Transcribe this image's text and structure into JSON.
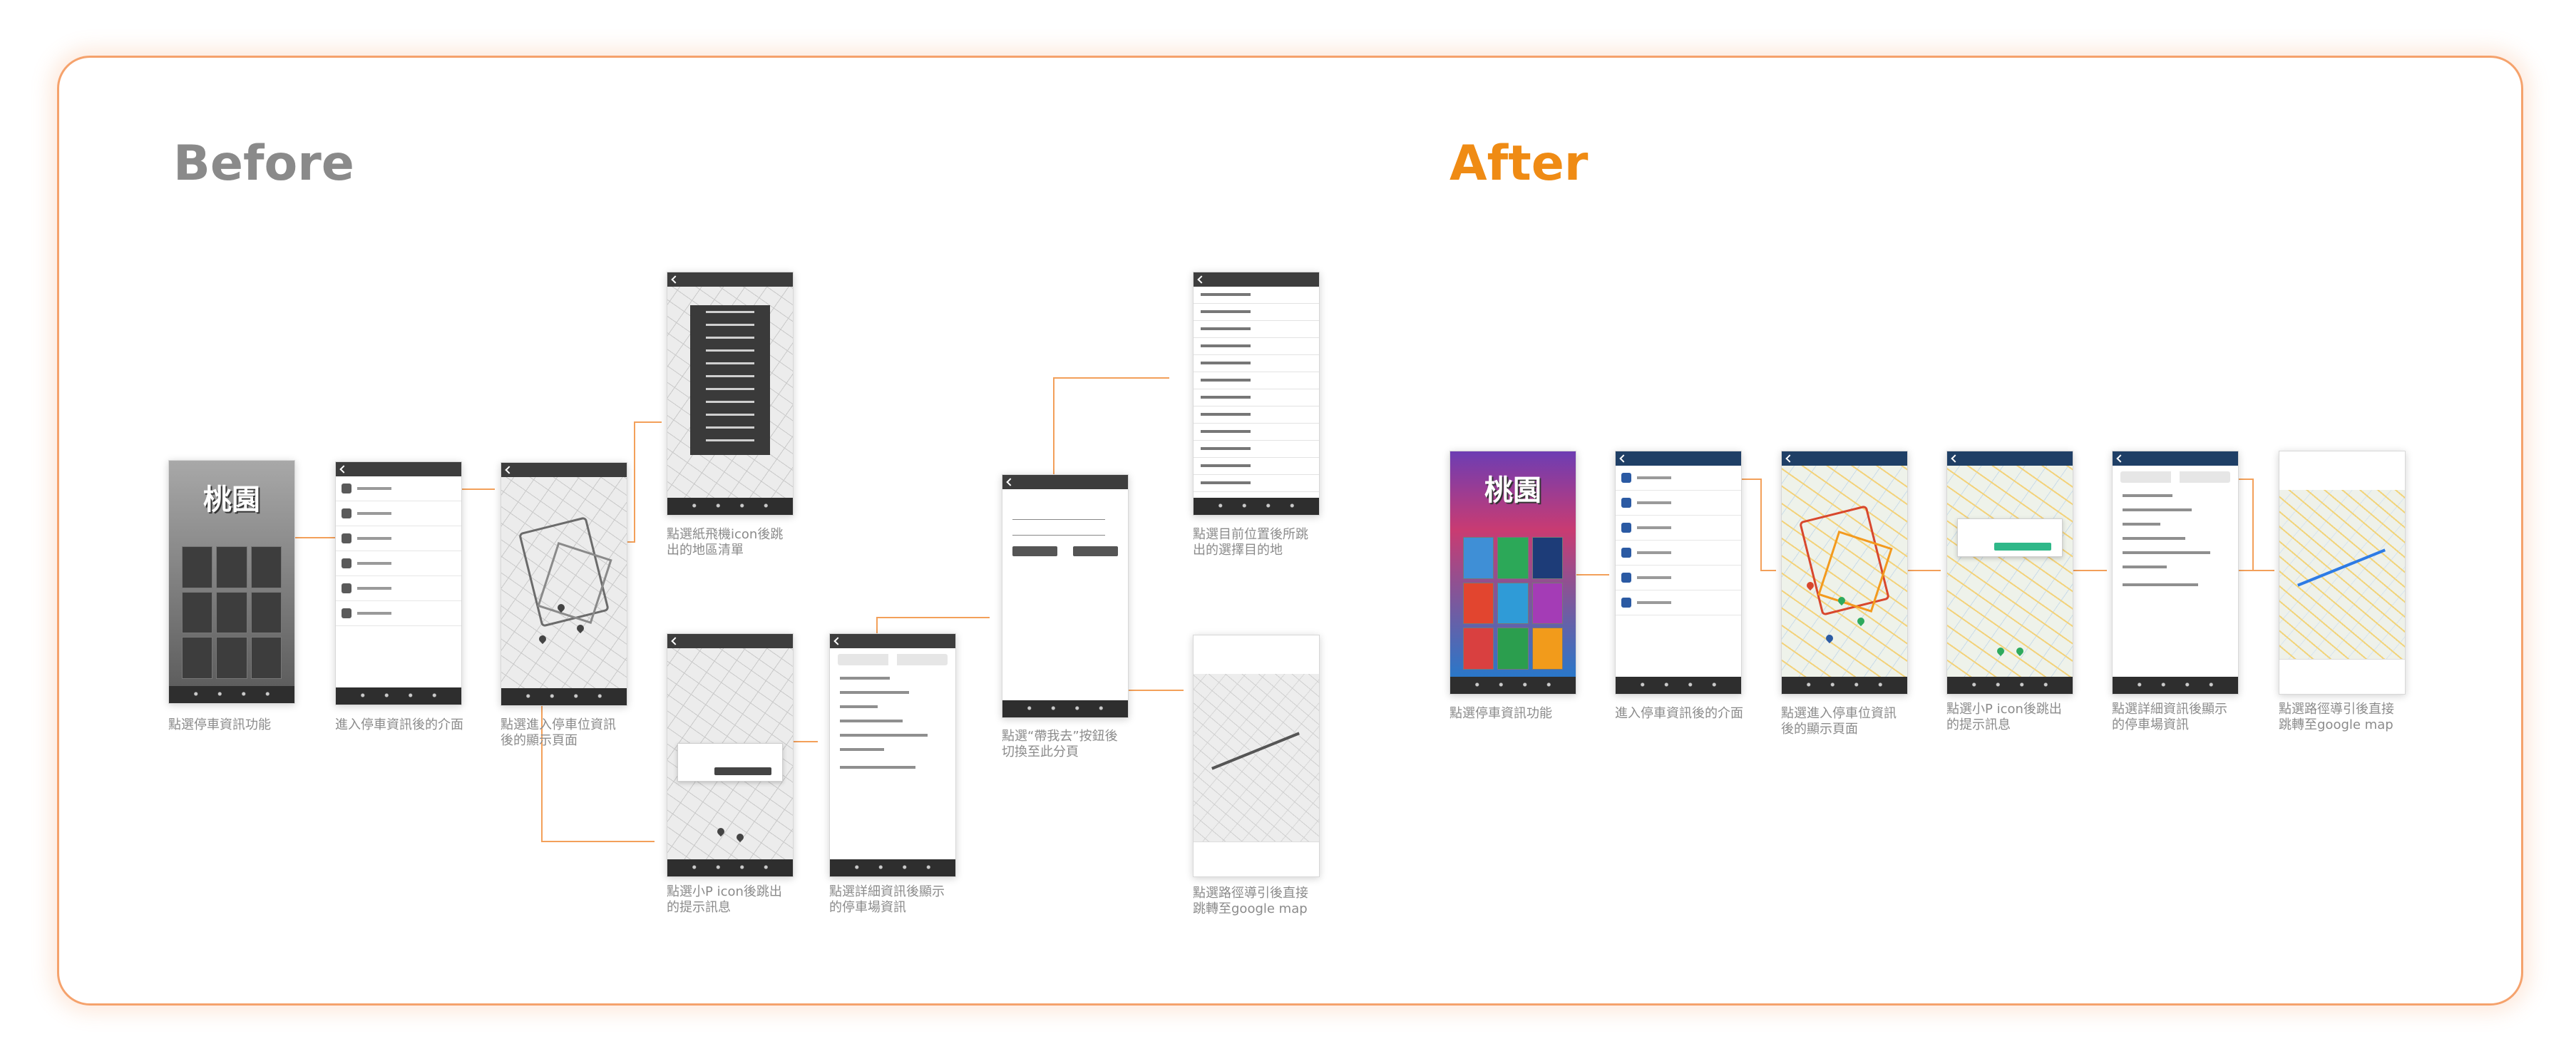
{
  "headings": {
    "before": "Before",
    "after": "After"
  },
  "colors": {
    "border": "#f5a26c",
    "before_heading": "#8a8a8a",
    "after_heading": "#ef8b14",
    "connector": "#f3a05a"
  },
  "before": {
    "captions": {
      "s1": "點選停車資訊功能",
      "s2": "進入停車資訊後的介面",
      "s3": "點選進入停車位資訊\n後的顯示頁面",
      "s4": "點選紙飛機icon後跳\n出的地區清單",
      "s5": "點選小P icon後跳出\n的提示訊息",
      "s6": "點選詳細資訊後顯示\n的停車場資訊",
      "s7": "點選“帶我去”按鈕後\n切換至此分頁",
      "s8": "點選目前位置後所跳\n出的選擇目的地",
      "s9": "點選路徑導引後直接\n跳轉至google map"
    }
  },
  "after": {
    "captions": {
      "s1": "點選停車資訊功能",
      "s2": "進入停車資訊後的介面",
      "s3": "點選進入停車位資訊\n後的顯示頁面",
      "s4": "點選小P icon後跳出\n的提示訊息",
      "s5": "點選詳細資訊後顯示\n的停車場資訊",
      "s6": "點選路徑導引後直接\n跳轉至google map"
    }
  }
}
